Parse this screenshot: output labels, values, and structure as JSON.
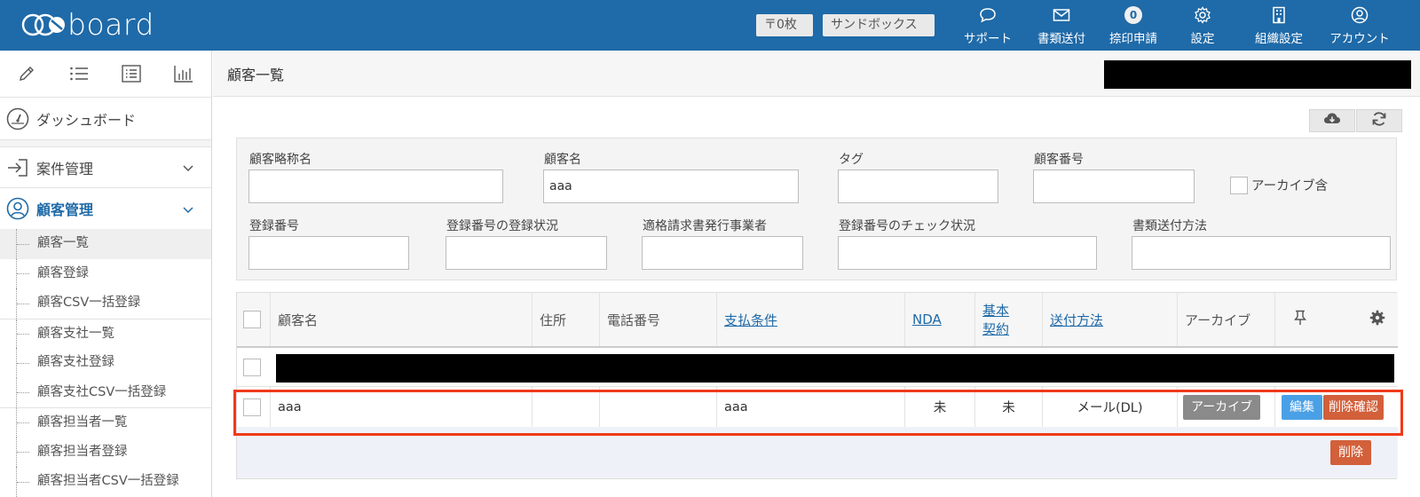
{
  "header": {
    "logo": "board",
    "tray_label": "〒0枚",
    "sandbox_label": "サンドボックス",
    "nav": [
      {
        "label": "サポート",
        "icon": "chat-bubble-icon"
      },
      {
        "label": "書類送付",
        "icon": "envelope-icon"
      },
      {
        "label": "捺印申請",
        "icon": "badge-count-icon",
        "badge": "0"
      },
      {
        "label": "設定",
        "icon": "gear-icon"
      },
      {
        "label": "組織設定",
        "icon": "building-icon"
      },
      {
        "label": "アカウント",
        "icon": "user-circle-icon"
      }
    ]
  },
  "sidebar": {
    "tools": [
      "pencil-icon",
      "bulleted-list-icon",
      "boxed-list-icon",
      "bar-chart-icon"
    ],
    "dashboard": "ダッシュボード",
    "anken": "案件管理",
    "kokyaku": "顧客管理",
    "items": [
      "顧客一覧",
      "顧客登録",
      "顧客CSV一括登録",
      "顧客支社一覧",
      "顧客支社登録",
      "顧客支社CSV一括登録",
      "顧客担当者一覧",
      "顧客担当者登録",
      "顧客担当者CSV一括登録"
    ]
  },
  "main": {
    "title": "顧客一覧",
    "accent_color": "#1f6aa8",
    "highlight_color": "#f03a1a"
  },
  "filters": {
    "short_name_label": "顧客略称名",
    "short_name_value": "",
    "name_label": "顧客名",
    "name_value": "aaa",
    "tag_label": "タグ",
    "tag_value": "",
    "number_label": "顧客番号",
    "number_value": "",
    "archive_label": "アーカイブ含",
    "reg_no_label": "登録番号",
    "reg_status_label": "登録番号の登録状況",
    "qualified_label": "適格請求書発行事業者",
    "check_status_label": "登録番号のチェック状況",
    "send_method_label": "書類送付方法"
  },
  "table": {
    "headers": {
      "name": "顧客名",
      "address": "住所",
      "phone": "電話番号",
      "payment": "支払条件",
      "nda": "NDA",
      "basic1": "基本",
      "basic2": "契約",
      "send": "送付方法",
      "archive": "アーカイブ"
    },
    "row": {
      "name": "aaa",
      "address": "",
      "phone": "",
      "payment": "aaa",
      "nda": "未",
      "basic": "未",
      "send": "メール(DL)",
      "archive_btn": "アーカイブ",
      "edit_btn": "編集",
      "delete_confirm_btn": "削除確認"
    },
    "delete_btn": "削除"
  }
}
